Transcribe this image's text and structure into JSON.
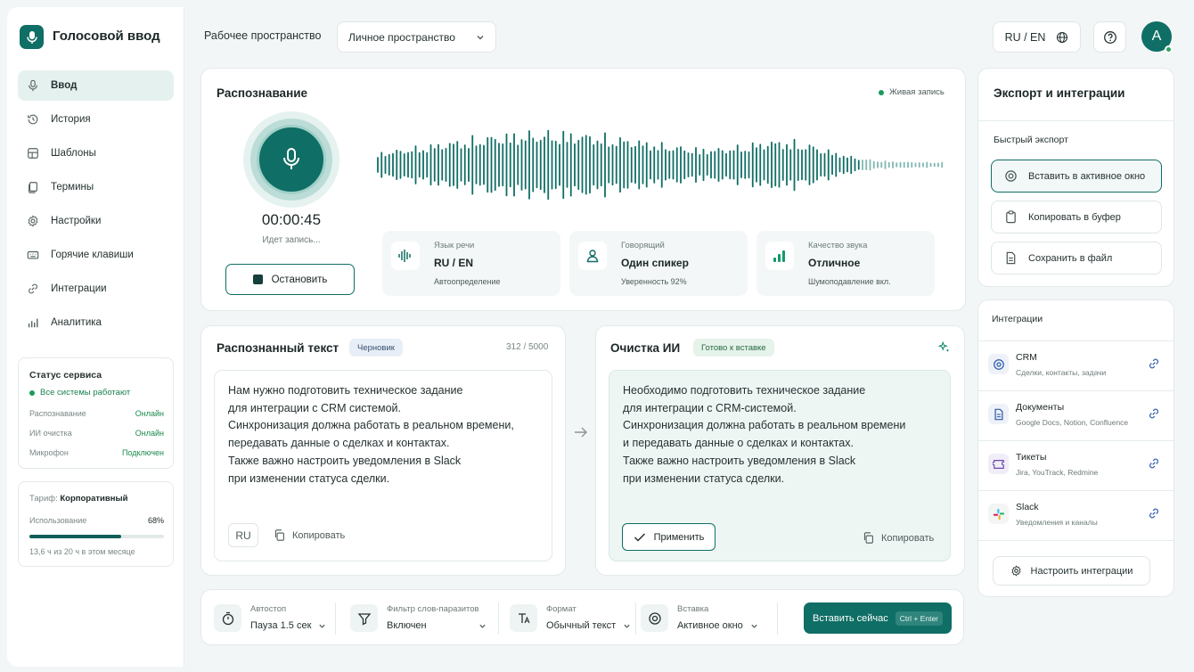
{
  "app": {
    "title": "Голосовой ввод"
  },
  "sidebar": {
    "items": [
      {
        "label": "Ввод",
        "icon": "mic-icon",
        "active": true
      },
      {
        "label": "История",
        "icon": "history-icon"
      },
      {
        "label": "Шаблоны",
        "icon": "templates-icon"
      },
      {
        "label": "Термины",
        "icon": "terms-icon"
      },
      {
        "label": "Настройки",
        "icon": "gear-icon"
      },
      {
        "label": "Горячие клавиши",
        "icon": "keyboard-icon"
      },
      {
        "label": "Интеграции",
        "icon": "link-icon"
      },
      {
        "label": "Аналитика",
        "icon": "chart-icon"
      }
    ],
    "status": {
      "title": "Статус сервиса",
      "all_ok": "Все системы работают",
      "rows": [
        {
          "label": "Распознавание",
          "value": "Онлайн"
        },
        {
          "label": "ИИ очистка",
          "value": "Онлайн"
        },
        {
          "label": "Микрофон",
          "value": "Подключен"
        }
      ]
    },
    "plan": {
      "label": "Тариф:",
      "name": "Корпоративный",
      "usage_label": "Использование",
      "usage_value": "68%",
      "usage_fraction": 0.68,
      "usage_text": "13,6 ч из 20 ч в этом месяце"
    }
  },
  "header": {
    "workspace_label": "Рабочее пространство",
    "workspace_value": "Личное пространство",
    "lang": "RU / EN",
    "avatar_letter": "A"
  },
  "recognition": {
    "title": "Распознавание",
    "live": "Живая запись",
    "timer": "00:00:45",
    "state": "Идет запись...",
    "stop_label": "Остановить",
    "stats": [
      {
        "label": "Язык речи",
        "value": "RU / EN",
        "sub": "Автоопределение",
        "icon": "waveform-icon"
      },
      {
        "label": "Говорящий",
        "value": "Один спикер",
        "sub": "Уверенность 92%",
        "icon": "user-icon"
      },
      {
        "label": "Качество звука",
        "value": "Отличное",
        "sub": "Шумоподавление вкл.",
        "icon": "signal-bars-icon"
      }
    ]
  },
  "raw": {
    "title": "Распознанный текст",
    "badge": "Черновик",
    "count": "312 / 5000",
    "lines": [
      "Нам нужно подготовить техническое задание",
      "для интеграции с CRM системой.",
      "Синхронизация должна работать в реальном времени,",
      "передавать данные о сделках и контактах.",
      "Также важно настроить уведомления в Slack",
      "при изменении статуса сделки."
    ],
    "lang_chip": "RU",
    "copy_label": "Копировать"
  },
  "ai": {
    "title": "Очистка ИИ",
    "badge": "Готово к вставке",
    "lines": [
      "Необходимо подготовить техническое задание",
      "для интеграции с CRM-системой.",
      "Синхронизация должна работать в реальном времени",
      "и передавать данные о сделках и контактах.",
      "Также важно настроить уведомления в Slack",
      "при изменении статуса сделки."
    ],
    "apply_label": "Применить",
    "copy_label": "Копировать"
  },
  "options": [
    {
      "label": "Автостоп",
      "value": "Пауза 1.5 сек",
      "icon": "timer-icon"
    },
    {
      "label": "Фильтр слов-паразитов",
      "value": "Включен",
      "icon": "filter-icon"
    },
    {
      "label": "Формат",
      "value": "Обычный текст",
      "icon": "text-format-icon"
    },
    {
      "label": "Вставка",
      "value": "Активное окно",
      "icon": "target-icon"
    }
  ],
  "insert": {
    "label": "Вставить сейчас",
    "shortcut": "Ctrl + Enter"
  },
  "export": {
    "title": "Экспорт и интеграции",
    "quick_label": "Быстрый экспорт",
    "buttons": [
      {
        "label": "Вставить в активное окно",
        "icon": "target-icon"
      },
      {
        "label": "Копировать в буфер",
        "icon": "clipboard-icon"
      },
      {
        "label": "Сохранить в файл",
        "icon": "file-icon"
      }
    ]
  },
  "integrations": {
    "title": "Интеграции",
    "items": [
      {
        "name": "CRM",
        "desc": "Сделки, контакты, задачи",
        "icon": "crm-icon"
      },
      {
        "name": "Документы",
        "desc": "Google Docs, Notion, Confluence",
        "icon": "document-icon"
      },
      {
        "name": "Тикеты",
        "desc": "Jira, YouTrack, Redmine",
        "icon": "ticket-icon"
      },
      {
        "name": "Slack",
        "desc": "Уведомления и каналы",
        "icon": "slack-icon"
      }
    ],
    "configure_label": "Настроить интеграции"
  },
  "colors": {
    "accent": "#0f6e65",
    "ok": "#1a8a4e"
  }
}
